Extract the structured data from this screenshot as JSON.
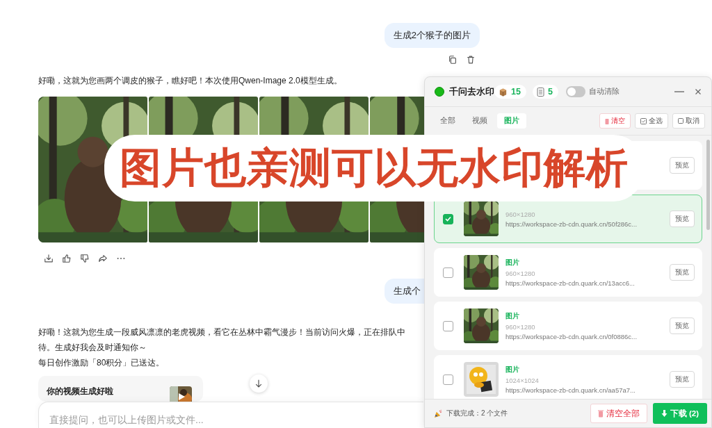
{
  "conversation": [
    {
      "kind": "user",
      "text": "生成2个猴子的图片",
      "tools": true
    },
    {
      "kind": "reply",
      "lines": [
        "好嘞，这就为您画两个调皮的猴子，瞧好吧！本次使用Qwen-Image 2.0模型生成。"
      ]
    },
    {
      "kind": "images"
    },
    {
      "kind": "actions"
    },
    {
      "kind": "user",
      "text": "生成个",
      "tools": false
    },
    {
      "kind": "reply",
      "lines": [
        "好嘞！这就为您生成一段威风凛凛的老虎视频，看它在丛林中霸气漫步！当前访问火爆，正在排队中",
        "待。生成好我会及时通知你～",
        "每日创作激励「80积分」已送达。"
      ]
    },
    {
      "kind": "video_card",
      "title": "你的视频生成好啦"
    }
  ],
  "composer": {
    "placeholder": "直接提问，也可以上传图片或文件..."
  },
  "overlay_caption": "图片也亲测可以无水印解析",
  "panel": {
    "title": "千问去水印",
    "counters": [
      {
        "kind": "box",
        "value": "15"
      },
      {
        "kind": "doc",
        "value": "5"
      }
    ],
    "auto_clear": {
      "label": "自动清除",
      "on": false
    },
    "tabs": [
      {
        "label": "全部",
        "selected": false
      },
      {
        "label": "视频",
        "selected": false
      },
      {
        "label": "图片",
        "selected": true
      }
    ],
    "actions": [
      {
        "kind": "danger",
        "label": "清空"
      },
      {
        "kind": "check",
        "label": "全选"
      },
      {
        "kind": "square",
        "label": "取消"
      }
    ],
    "items": [
      {
        "selected": false,
        "preview": "预览"
      },
      {
        "selected": true,
        "checked": true,
        "size": "960×1280",
        "url": "https://workspace-zb-cdn.quark.cn/50f286c...",
        "preview": "预览"
      },
      {
        "selected": false,
        "checked": false,
        "title": "图片",
        "size": "960×1280",
        "url": "https://workspace-zb-cdn.quark.cn/13acc6...",
        "preview": "预览"
      },
      {
        "selected": false,
        "checked": false,
        "title": "图片",
        "size": "960×1280",
        "url": "https://workspace-zb-cdn.quark.cn/0f0886c...",
        "preview": "预览"
      },
      {
        "selected": false,
        "checked": false,
        "thumb": {
          "kind": "sticker"
        },
        "title": "图片",
        "size": "1024×1024",
        "url": "https://workspace-zb-cdn.quark.cn/aa57a7...",
        "preview": "预览"
      }
    ],
    "footer": {
      "status": "下载完成：2 个文件",
      "clear_all": "清空全部",
      "download": "下载 (2)"
    }
  }
}
